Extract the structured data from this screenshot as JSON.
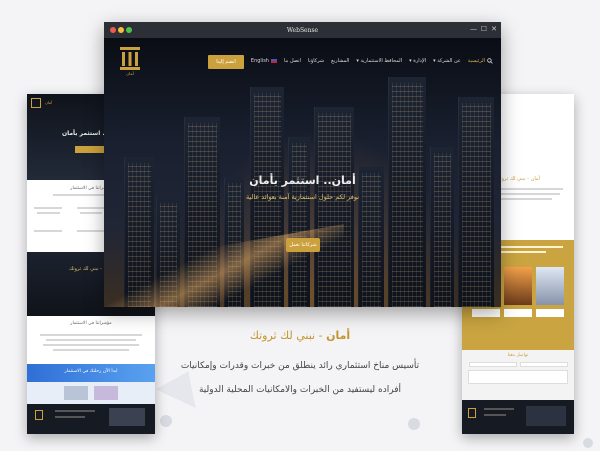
{
  "window": {
    "title": "WebSense",
    "controls": {
      "minimize": "—",
      "restore": "☐",
      "close": "✕"
    }
  },
  "brand": {
    "logo_text": "أمان"
  },
  "nav": {
    "items": [
      {
        "label": "الرئيسية",
        "active": true
      },
      {
        "label": "عن الشركة ▾"
      },
      {
        "label": "الإدارة ▾"
      },
      {
        "label": "المحافظ الاستثمارية ▾"
      },
      {
        "label": "المشاريع"
      },
      {
        "label": "شركاؤنا"
      },
      {
        "label": "اتصل بنا"
      }
    ],
    "language": "English",
    "cta": "انضم إلينا"
  },
  "hero": {
    "title": "أمان.. استثمر بأمان",
    "subtitle": "نوفر لكم حلول استثمارية آمنة بعوائد عالية",
    "button": "شركاتنا تعمل"
  },
  "tagline": {
    "brand": "أمان",
    "rest": " - نبني لك ثروتك"
  },
  "description": {
    "line1": "تأسيس مناخ استثماري رائد ينطلق من خبرات وقدرات وإمكانيات",
    "line2": "أفراده ليستفيد من الخبرات والامكانيات المحلية الدولية"
  },
  "left_phone": {
    "header_logo": "أمان",
    "hero_title": "أمان.. استثمر بأمان",
    "section1_title": "مؤشراتنا في الاستثمار",
    "section2_title": "أمان - نبني لك ثروتك",
    "section3_title": "مؤشراتنا في الاستثمار",
    "banner": "ابدأ الآن رحلتك في الاستثمار"
  },
  "right_phone": {
    "title": "أمان - نبني لك ثروتك",
    "form_title": "تواصل معنا"
  },
  "colors": {
    "gold": "#caa13d",
    "dark": "#121620",
    "background": "#f4f4f6"
  }
}
